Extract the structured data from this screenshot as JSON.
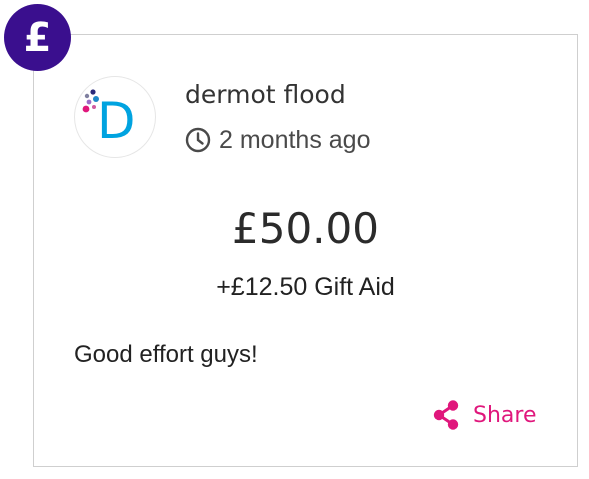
{
  "badge": {
    "symbol": "£"
  },
  "donation": {
    "donor_name": "dermot flood",
    "time_ago": "2 months ago",
    "amount": "£50.00",
    "gift_aid": "+£12.50 Gift Aid",
    "message": "Good effort guys!"
  },
  "actions": {
    "share_label": "Share"
  },
  "icons": {
    "badge": "pound-icon",
    "avatar": "d-logo-icon",
    "time": "clock-icon",
    "share": "share-icon"
  },
  "avatar": {
    "letter": "D"
  },
  "colors": {
    "badge_bg": "#3a0f8e",
    "share": "#e0177c",
    "avatar_letter": "#00a3e0",
    "text": "#222222"
  }
}
